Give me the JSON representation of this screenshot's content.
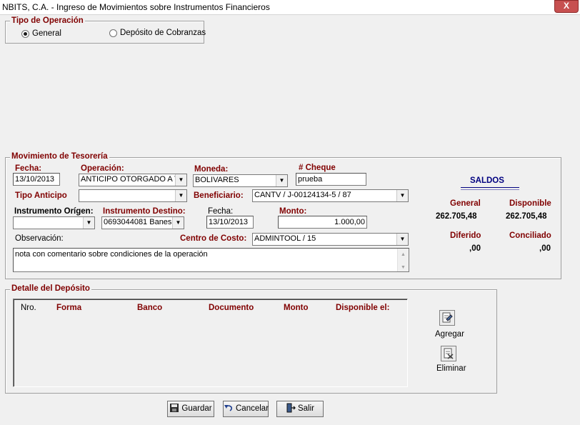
{
  "window": {
    "title": "NBITS, C.A. - Ingreso de Movimientos sobre Instrumentos Financieros",
    "close_glyph": "X"
  },
  "tipo_operacion": {
    "legend": "Tipo de Operación",
    "options": [
      {
        "label": "General",
        "selected": true
      },
      {
        "label": "Depósito de Cobranzas",
        "selected": false
      }
    ]
  },
  "movimiento": {
    "legend": "Movimiento de Tesorería",
    "fecha_label": "Fecha:",
    "fecha_value": "13/10/2013",
    "operacion_label": "Operación:",
    "operacion_value": "ANTICIPO OTORGADO A T",
    "moneda_label": "Moneda:",
    "moneda_value": "BOLIVARES",
    "cheque_label": "# Cheque",
    "cheque_value": "prueba",
    "tipo_anticipo_label": "Tipo Anticipo",
    "tipo_anticipo_value": "",
    "beneficiario_label": "Beneficiario:",
    "beneficiario_value": "CANTV / J-00124134-5 / 87",
    "instr_origen_label": "Instrumento Orígen:",
    "instr_origen_value": "",
    "instr_destino_label": "Instrumento Destino:",
    "instr_destino_value": "0693044081 Banes",
    "fecha2_label": "Fecha:",
    "fecha2_value": "13/10/2013",
    "monto_label": "Monto:",
    "monto_value": "1.000,00",
    "observacion_label": "Observación:",
    "observacion_value": "nota con comentario sobre condiciones de la operación",
    "centro_costo_label": "Centro de Costo:",
    "centro_costo_value": "ADMINTOOL / 15"
  },
  "saldos": {
    "title": "SALDOS",
    "general_label": "General",
    "general_value": "262.705,48",
    "disponible_label": "Disponible",
    "disponible_value": "262.705,48",
    "diferido_label": "Diferido",
    "diferido_value": ",00",
    "conciliado_label": "Conciliado",
    "conciliado_value": ",00"
  },
  "detalle": {
    "legend": "Detalle del Depósito",
    "columns": [
      "Nro.",
      "Forma",
      "Banco",
      "Documento",
      "Monto",
      "Disponible el:"
    ],
    "agregar_label": "Agregar",
    "eliminar_label": "Eliminar"
  },
  "footer": {
    "guardar": "Guardar",
    "cancelar": "Cancelar",
    "salir": "Salir"
  },
  "colors": {
    "maroon": "#800000",
    "navy": "#000080"
  },
  "icons": [
    "close-icon",
    "radio-selected-icon",
    "radio-unselected-icon",
    "dropdown-arrow-icon",
    "add-record-icon",
    "delete-record-icon",
    "floppy-disk-icon",
    "undo-arrow-icon",
    "exit-door-icon"
  ]
}
